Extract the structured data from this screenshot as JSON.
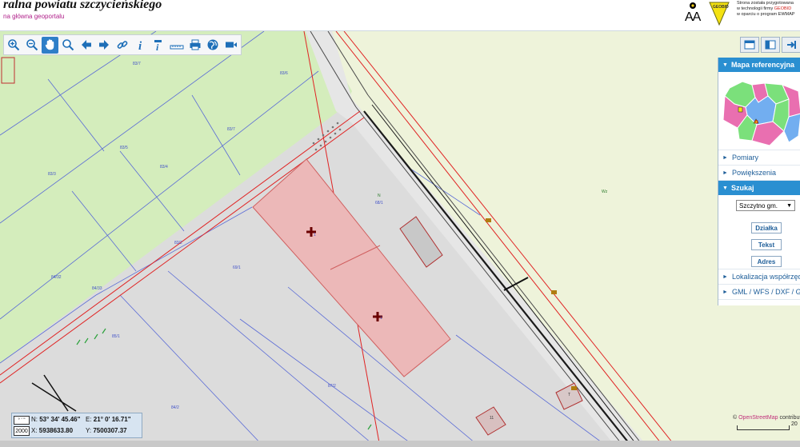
{
  "header": {
    "title": "ralna powiatu szczycieńskiego",
    "portal_link": "na główna geoportalu",
    "font_toggle_label": "AA",
    "logo_text": "GEOBID",
    "credit_line1": "Strona została przygotowana",
    "credit_line2_prefix": "w technologii firmy ",
    "credit_brand": "GEOBID",
    "credit_line3": "w oparciu o program EWMAP"
  },
  "toolbar": {
    "tools": [
      "zoom-in",
      "zoom-out",
      "pan",
      "zoom-window",
      "back",
      "forward",
      "link",
      "info",
      "identify",
      "measure",
      "print",
      "globe",
      "camera"
    ]
  },
  "panel": {
    "ref_map_title": "Mapa referencyjna",
    "items": {
      "pomiary": "Pomiary",
      "powiekszenia": "Powiększenia",
      "szukaj": "Szukaj",
      "lokalizacja": "Lokalizacja współrzędnych",
      "gml": "GML / WFS / DXF / GPX"
    },
    "search": {
      "gmina_value": "Szczytno gm.",
      "btn_dzialka": "Działka",
      "btn_tekst": "Tekst",
      "btn_adres": "Adres"
    }
  },
  "coords": {
    "system_top": "° ' \"",
    "system": "2000",
    "n_label": "N:",
    "n_value": "53° 34' 45.46\"",
    "e_label": "E:",
    "e_value": "21° 0' 16.71\"",
    "x_label": "X:",
    "x_value": "5938633.80",
    "y_label": "Y:",
    "y_value": "7500307.37"
  },
  "map": {
    "attribution_prefix": "© ",
    "attribution_osm": "OpenStreetMap",
    "attribution_suffix": " contributors",
    "scale_label": "20",
    "labels": {
      "l1": "83/7",
      "l2": "83/6",
      "l3": "83/5",
      "l4": "83/4",
      "l5": "83/3",
      "l6": "83/2",
      "l7": "84/2",
      "l8": "84/32",
      "l9": "84/33",
      "l10": "6/5",
      "l11": "6/4",
      "l12": "6/3",
      "l13": "6/2",
      "l14": "6/1",
      "l15": "6/6",
      "l16": "69/1",
      "l17": "68/1",
      "l18": "87/2",
      "l19": "85/1",
      "l20": "N",
      "l21": "Wz",
      "l22": "Wz",
      "l23": "1",
      "l24": "T",
      "l25": "11"
    },
    "colors": {
      "field_green": "#d4edbc",
      "grey_parcel": "#dcdcdc",
      "yellow_area": "#eef3da",
      "selected_parcel": "#ecb8b8",
      "panel_accent": "#2a8fd1"
    }
  }
}
